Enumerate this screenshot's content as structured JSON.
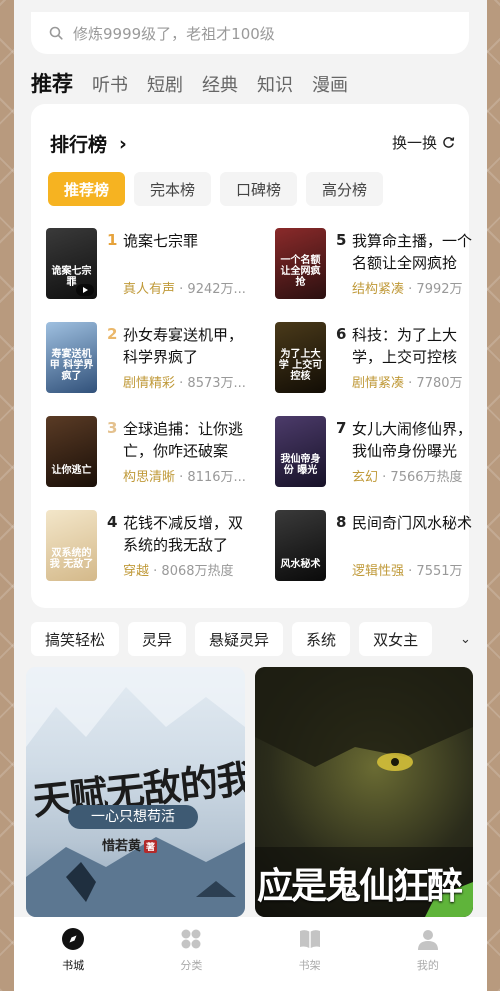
{
  "search": {
    "placeholder": "修炼9999级了，老祖才100级"
  },
  "top_tabs": [
    "推荐",
    "听书",
    "短剧",
    "经典",
    "知识",
    "漫画"
  ],
  "ranking": {
    "title": "排行榜",
    "swap_label": "换一换",
    "chips": [
      "推荐榜",
      "完本榜",
      "口碑榜",
      "高分榜"
    ],
    "books": [
      {
        "rank": "1",
        "title": "诡案七宗罪",
        "genre": "真人有声",
        "heat": "9242万...",
        "cover_text": "诡案七宗罪",
        "colors": [
          "#3a3a3a",
          "#0f0f0f"
        ],
        "rank_color": "#e6a33c",
        "has_audio": true
      },
      {
        "rank": "2",
        "title": "孙女寿宴送机甲，科学界疯了",
        "genre": "剧情精彩",
        "heat": "8573万...",
        "cover_text": "寿宴送机甲 科学界疯了",
        "colors": [
          "#9fc0e0",
          "#31517a"
        ],
        "rank_color": "#eab76a"
      },
      {
        "rank": "3",
        "title": "全球追捕：让你逃亡，你咋还破案",
        "genre": "构思清晰",
        "heat": "8116万...",
        "cover_text": "让你逃亡",
        "colors": [
          "#5a3b25",
          "#1a0f08"
        ],
        "rank_color": "#e4c18e"
      },
      {
        "rank": "4",
        "title": "花钱不减反增，双系统的我无敌了",
        "genre": "穿越",
        "heat": "8068万热度",
        "cover_text": "双系统的我 无敌了",
        "colors": [
          "#f3e6c9",
          "#d4b98a"
        ],
        "rank_color": "#222222"
      },
      {
        "rank": "5",
        "title": "我算命主播，一个名额让全网疯抢",
        "genre": "结构紧凑",
        "heat": "7992万",
        "cover_text": "一个名额 让全网疯抢",
        "colors": [
          "#8a2a2a",
          "#2b1010"
        ],
        "rank_color": "#222222"
      },
      {
        "rank": "6",
        "title": "科技：为了上大学，上交可控核",
        "genre": "剧情紧凑",
        "heat": "7780万",
        "cover_text": "为了上大学 上交可控核",
        "colors": [
          "#4a3a1a",
          "#120d05"
        ],
        "rank_color": "#222222"
      },
      {
        "rank": "7",
        "title": "女儿大闹修仙界，我仙帝身份曝光",
        "genre": "玄幻",
        "heat": "7566万热度",
        "cover_text": "我仙帝身份 曝光",
        "colors": [
          "#4c3b6a",
          "#171228"
        ],
        "rank_color": "#222222"
      },
      {
        "rank": "8",
        "title": "民间奇门风水秘术",
        "genre": "逻辑性强",
        "heat": "7551万",
        "cover_text": "风水秘术",
        "colors": [
          "#3a3a3a",
          "#0a0a0a"
        ],
        "rank_color": "#222222"
      }
    ]
  },
  "genres": [
    "搞笑轻松",
    "灵异",
    "悬疑灵异",
    "系统",
    "双女主"
  ],
  "features": [
    {
      "title": "天赋无敌的我",
      "subtitle": "一心只想苟活",
      "author": "惜若黄",
      "seal": "著"
    },
    {
      "title": "应是鬼仙狂醉"
    }
  ],
  "nav": [
    "书城",
    "分类",
    "书架",
    "我的"
  ],
  "colors": {
    "accent": "#f6b321",
    "genre_text": "#c09a3a"
  }
}
